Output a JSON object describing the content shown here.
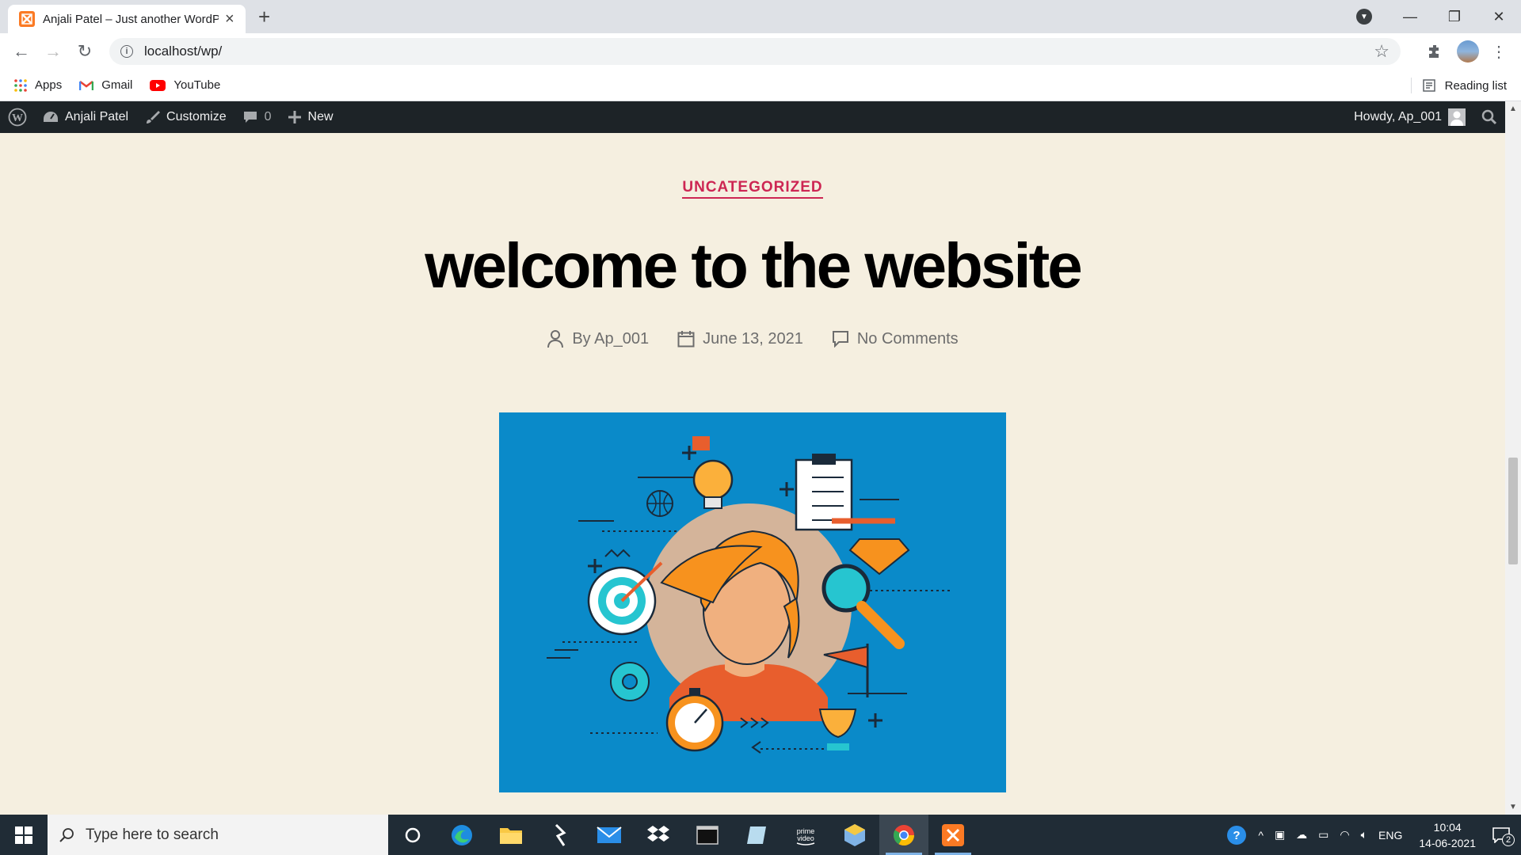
{
  "browser": {
    "tab_title": "Anjali Patel – Just another WordP",
    "url": "localhost/wp/",
    "bookmarks": [
      "Apps",
      "Gmail",
      "YouTube"
    ],
    "reading_list": "Reading list"
  },
  "admin_bar": {
    "site_name": "Anjali Patel",
    "customize": "Customize",
    "comments_count": "0",
    "new": "New",
    "howdy": "Howdy, Ap_001"
  },
  "post": {
    "category": "UNCATEGORIZED",
    "title": "welcome to the website",
    "author": "By Ap_001",
    "date": "June 13, 2021",
    "comments": "No Comments"
  },
  "taskbar": {
    "search_placeholder": "Type here to search",
    "language": "ENG",
    "time": "10:04",
    "date": "14-06-2021",
    "notification_count": "2"
  },
  "colors": {
    "page_bg": "#f5efe0",
    "accent": "#cd2653",
    "adminbar_bg": "#1d2327",
    "image_bg": "#0a8ac9"
  }
}
